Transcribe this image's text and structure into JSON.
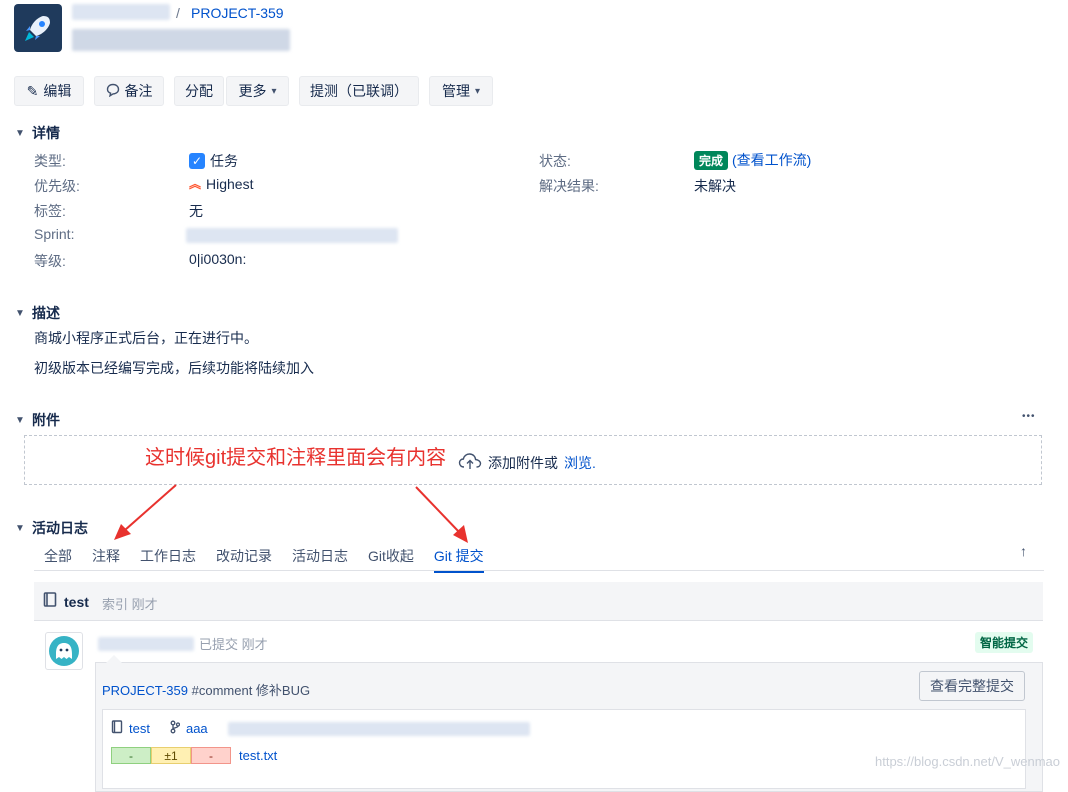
{
  "breadcrumb": {
    "separator": "/",
    "project_key": "PROJECT-359"
  },
  "toolbar": {
    "edit": "编辑",
    "comment": "备注",
    "assign": "分配",
    "more": "更多",
    "test": "提测（已联调）",
    "admin": "管理"
  },
  "details": {
    "heading": "详情",
    "type_label": "类型:",
    "type_value": "任务",
    "priority_label": "优先级:",
    "priority_value": "Highest",
    "labels_label": "标签:",
    "labels_value": "无",
    "sprint_label": "Sprint:",
    "rank_label": "等级:",
    "rank_value": "0|i0030n:",
    "status_label": "状态:",
    "status_value": "完成",
    "status_link": "(查看工作流)",
    "resolution_label": "解决结果:",
    "resolution_value": "未解决"
  },
  "description": {
    "heading": "描述",
    "line1": "商城小程序正式后台，正在进行中。",
    "line2": "初级版本已经编写完成，后续功能将陆续加入"
  },
  "attachments": {
    "heading": "附件",
    "more": "•••",
    "drop_text": "添加附件或",
    "browse": "浏览."
  },
  "annotation": "这时候git提交和注释里面会有内容",
  "activity": {
    "heading": "活动日志",
    "tabs": [
      "全部",
      "注释",
      "工作日志",
      "改动记录",
      "活动日志",
      "Git收起",
      "Git 提交"
    ],
    "active_tab": 6,
    "scroll_top": "↑"
  },
  "commit": {
    "repo": "test",
    "repo_meta": "索引 刚才",
    "submitted": "已提交 刚才",
    "smart_badge": "智能提交",
    "msg_key": "PROJECT-359",
    "msg_text": "#comment 修补BUG",
    "view_full": "查看完整提交",
    "file_repo": "test",
    "branch": "aaa",
    "diff_removed": "-",
    "diff_changed": "±1",
    "diff_removed2": "-",
    "file_name": "test.txt"
  },
  "watermark": "https://blog.csdn.net/V_wenmao",
  "colors": {
    "link": "#0052cc",
    "done": "#00875a",
    "annotation": "#e8322e"
  }
}
